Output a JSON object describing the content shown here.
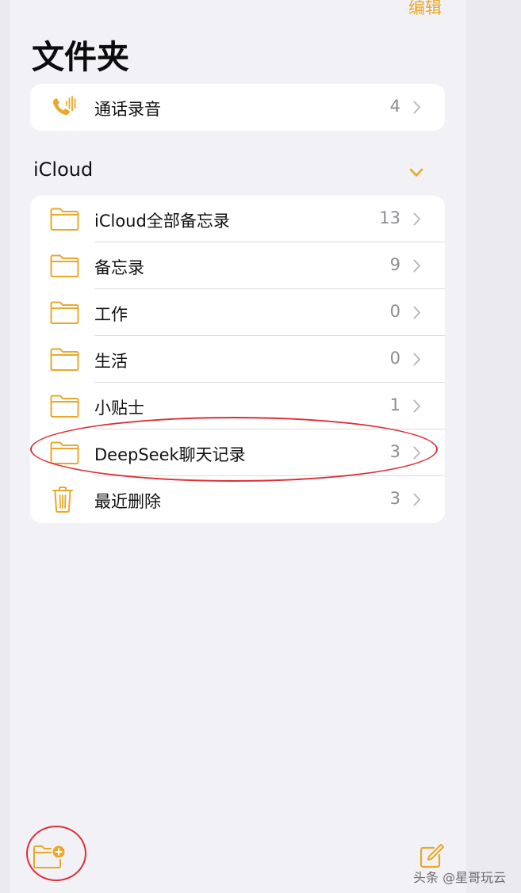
{
  "header": {
    "edit_label": "编辑",
    "title": "文件夹"
  },
  "top_folders": [
    {
      "label": "通话录音",
      "count": "4",
      "icon": "phone-waveform-icon"
    }
  ],
  "icloud_section": {
    "title": "iCloud",
    "toggle_icon": "chevron-down-icon",
    "folders": [
      {
        "label": "iCloud全部备忘录",
        "count": "13",
        "icon": "folder-icon"
      },
      {
        "label": "备忘录",
        "count": "9",
        "icon": "folder-icon"
      },
      {
        "label": "工作",
        "count": "0",
        "icon": "folder-icon"
      },
      {
        "label": "生活",
        "count": "0",
        "icon": "folder-icon"
      },
      {
        "label": "小贴士",
        "count": "1",
        "icon": "folder-icon"
      },
      {
        "label": "DeepSeek聊天记录",
        "count": "3",
        "icon": "folder-icon"
      },
      {
        "label": "最近删除",
        "count": "3",
        "icon": "trash-icon"
      }
    ]
  },
  "toolbar": {
    "new_folder_icon": "new-folder-icon",
    "compose_icon": "compose-icon"
  },
  "watermark": "头条 @星哥玩云",
  "colors": {
    "accent": "#e8a92a",
    "annotation": "#dc2f36",
    "background": "#f2f1f6",
    "card": "#ffffff"
  }
}
